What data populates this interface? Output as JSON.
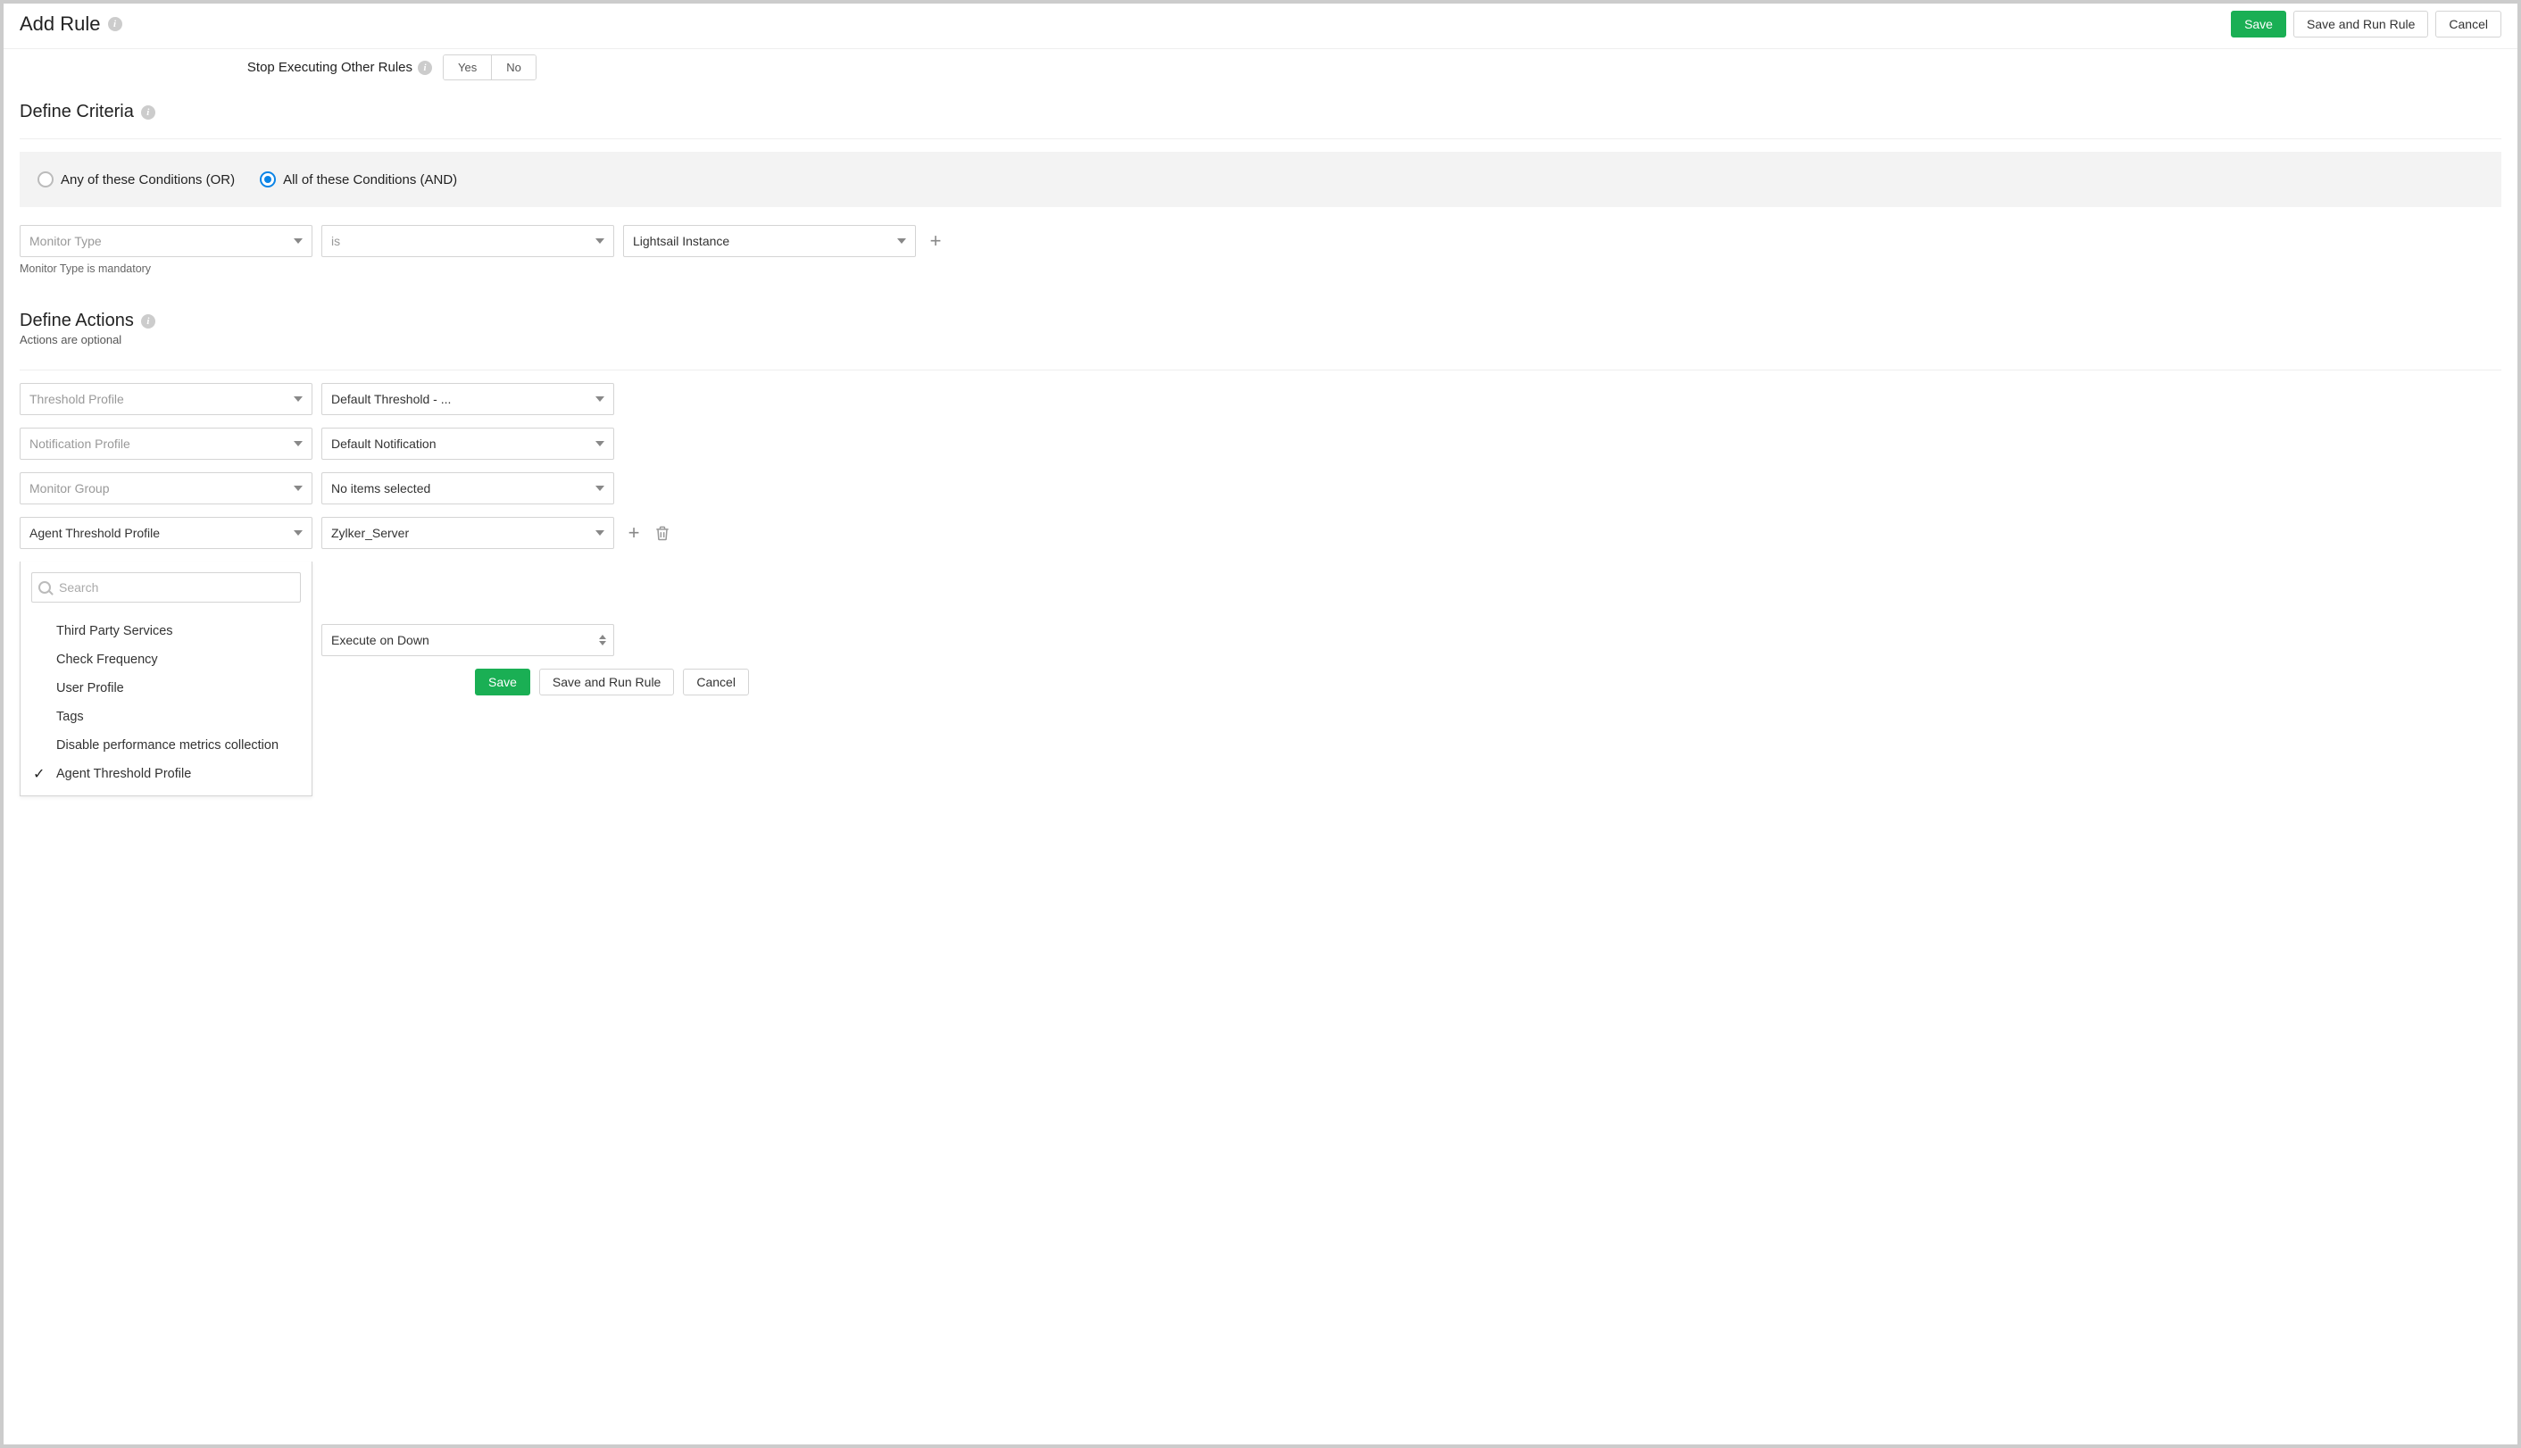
{
  "header": {
    "title": "Add Rule",
    "save": "Save",
    "save_run": "Save and Run Rule",
    "cancel": "Cancel"
  },
  "stop_exec": {
    "label": "Stop Executing Other Rules",
    "yes": "Yes",
    "no": "No"
  },
  "criteria": {
    "heading": "Define Criteria",
    "radio_any": "Any of these Conditions (OR)",
    "radio_all": "All of these Conditions (AND)",
    "field_monitor_type": "Monitor Type",
    "op_is": "is",
    "value_lightsail": "Lightsail Instance",
    "mandatory_note": "Monitor Type is mandatory"
  },
  "actions": {
    "heading": "Define Actions",
    "optional_note": "Actions are optional",
    "rows": {
      "threshold_profile_label": "Threshold Profile",
      "threshold_profile_value": "Default Threshold - ...",
      "notification_profile_label": "Notification Profile",
      "notification_profile_value": "Default Notification",
      "monitor_group_label": "Monitor Group",
      "monitor_group_value": "No items selected",
      "agent_threshold_label": "Agent Threshold Profile",
      "agent_threshold_value": "Zylker_Server",
      "execute_value": "Execute on Down"
    },
    "dropdown": {
      "search_placeholder": "Search",
      "items": [
        {
          "label": "Third Party Services",
          "selected": false
        },
        {
          "label": "Check Frequency",
          "selected": false
        },
        {
          "label": "User Profile",
          "selected": false
        },
        {
          "label": "Tags",
          "selected": false
        },
        {
          "label": "Disable performance metrics collection",
          "selected": false
        },
        {
          "label": "Agent Threshold Profile",
          "selected": true
        }
      ]
    }
  },
  "footer": {
    "save": "Save",
    "save_run": "Save and Run Rule",
    "cancel": "Cancel"
  }
}
